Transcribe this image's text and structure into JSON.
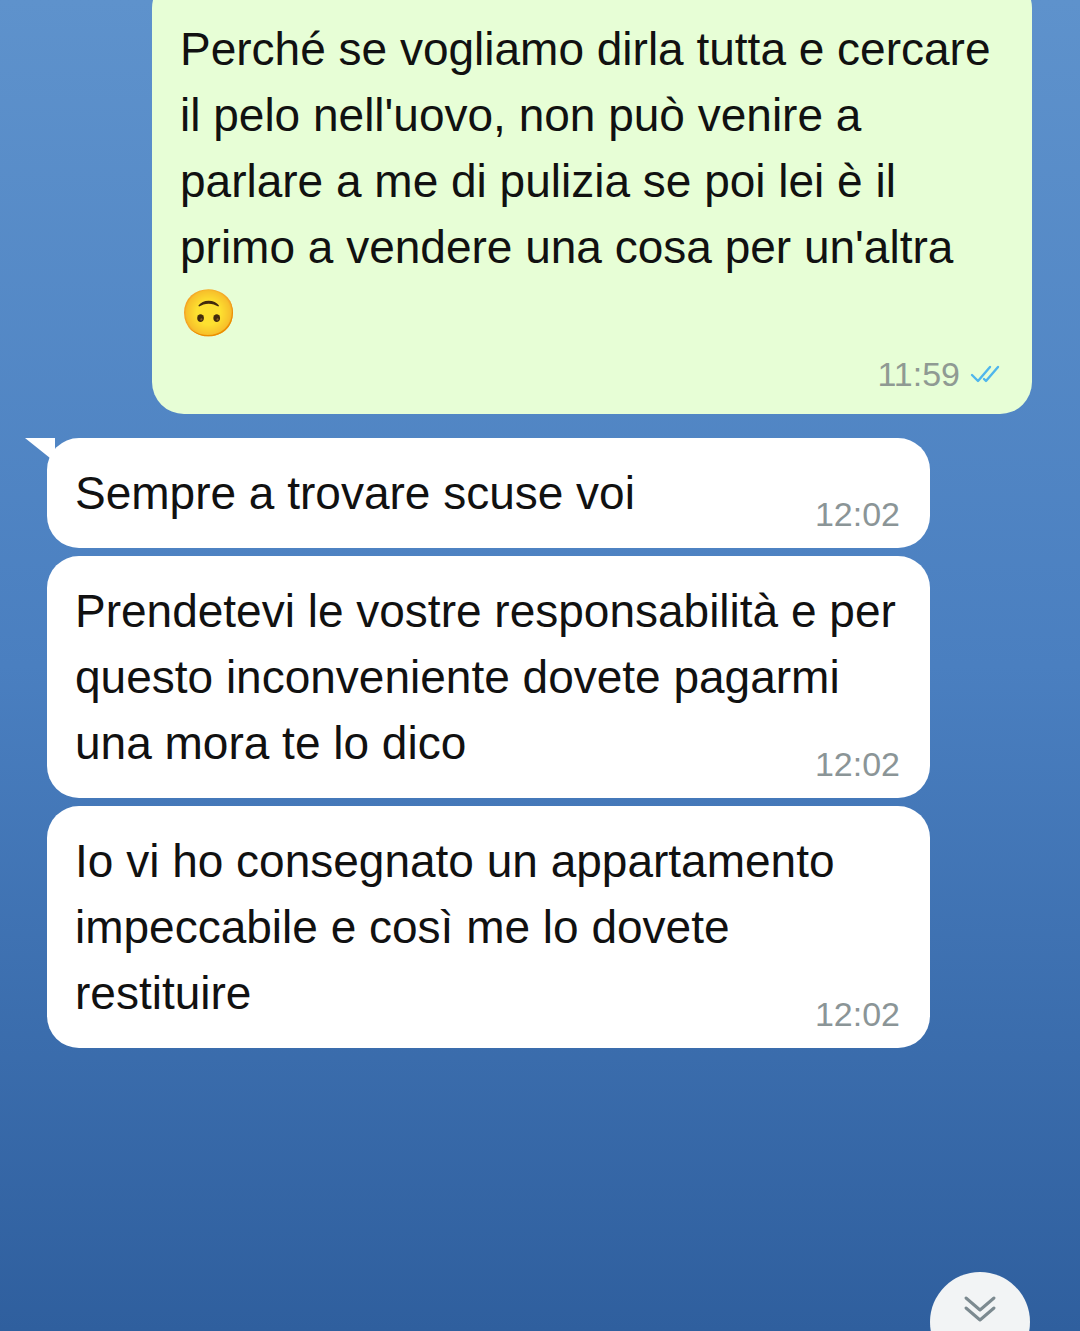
{
  "chat": {
    "messages": [
      {
        "kind": "outgoing",
        "text": "Perché se vogliamo dirla tutta e cercare il pelo nell'uovo, non può venire a parlare a me di pulizia se poi lei è il primo a vendere una cosa per un'altra 🙃",
        "time": "11:59",
        "read": true,
        "tail": false
      },
      {
        "kind": "incoming",
        "text": "Sempre a trovare scuse voi",
        "time": "12:02",
        "read": false,
        "tail": true
      },
      {
        "kind": "incoming",
        "text": "Prendetevi le vostre responsabilità e per questo inconveniente dovete pagarmi una mora te lo dico",
        "time": "12:02",
        "read": false,
        "tail": false
      },
      {
        "kind": "incoming",
        "text": "Io vi ho consegnato un appartamento impeccabile e così me lo dovete restituire",
        "time": "12:02",
        "read": false,
        "tail": false
      }
    ]
  }
}
